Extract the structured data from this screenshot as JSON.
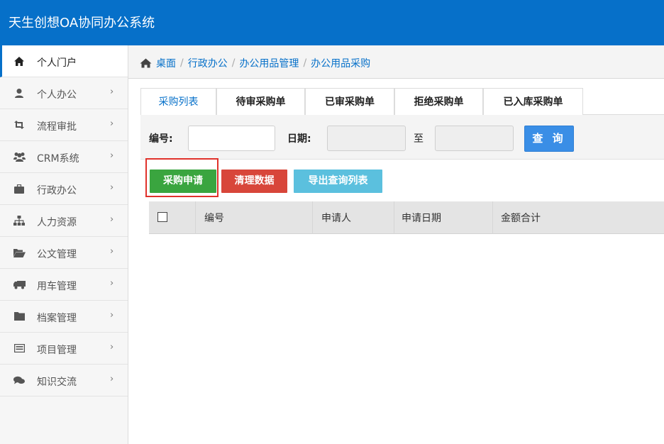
{
  "app": {
    "title": "天生创想OA协同办公系统"
  },
  "sidebar": {
    "items": [
      {
        "label": "个人门户",
        "icon": "home-icon",
        "active": true,
        "arrow": ""
      },
      {
        "label": "个人办公",
        "icon": "user-icon",
        "arrow": "›"
      },
      {
        "label": "流程审批",
        "icon": "retweet-icon",
        "arrow": "›"
      },
      {
        "label": "CRM系统",
        "icon": "users-icon",
        "arrow": "›"
      },
      {
        "label": "行政办公",
        "icon": "briefcase-icon",
        "arrow": "›"
      },
      {
        "label": "人力资源",
        "icon": "sitemap-icon",
        "arrow": "›"
      },
      {
        "label": "公文管理",
        "icon": "folder-open-icon",
        "arrow": "›"
      },
      {
        "label": "用车管理",
        "icon": "truck-icon",
        "arrow": "›"
      },
      {
        "label": "档案管理",
        "icon": "folder-icon",
        "arrow": "›"
      },
      {
        "label": "项目管理",
        "icon": "list-alt-icon",
        "arrow": "›"
      },
      {
        "label": "知识交流",
        "icon": "comments-icon",
        "arrow": "›"
      }
    ]
  },
  "breadcrumb": {
    "home_icon": "home-icon",
    "items": [
      "桌面",
      "行政办公",
      "办公用品管理",
      "办公用品采购"
    ],
    "separator": "/"
  },
  "tabs": [
    {
      "label": "采购列表",
      "active": true
    },
    {
      "label": "待审采购单"
    },
    {
      "label": "已审采购单"
    },
    {
      "label": "拒绝采购单"
    },
    {
      "label": "已入库采购单"
    }
  ],
  "search": {
    "number_label": "编号:",
    "number_value": "",
    "date_label": "日期:",
    "date_from": "",
    "to_label": "至",
    "date_to": "",
    "query_label": "查 询"
  },
  "actions": {
    "apply_label": "采购申请",
    "clear_label": "清理数据",
    "export_label": "导出查询列表"
  },
  "table": {
    "columns": [
      "编号",
      "申请人",
      "申请日期",
      "金额合计"
    ],
    "rows": []
  },
  "colors": {
    "header": "#0670c9",
    "apply_button": "#3aa53f",
    "clear_button": "#d8463a",
    "export_button": "#5bc0de",
    "query_button": "#3a8ee6",
    "highlight": "#e0322b"
  }
}
